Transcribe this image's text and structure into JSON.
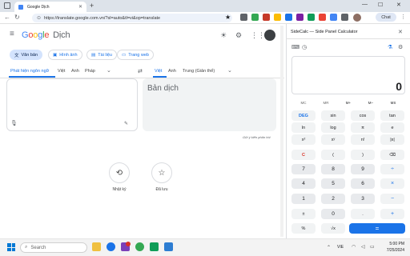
{
  "browser": {
    "tab_title": "Google Dịch",
    "new_tab": "+",
    "url": "https://translate.google.com.vn/?sl=auto&tl=vi&op=translate",
    "minimize": "—",
    "maximize": "☐",
    "close": "✕",
    "profile_label": "Chat"
  },
  "translate": {
    "logo_google": "Google",
    "logo_dich": "Dịch",
    "modes": [
      "Văn bản",
      "Hình ảnh",
      "Tài liệu",
      "Trang web"
    ],
    "source_langs": [
      "Phát hiện ngôn ngữ",
      "Việt",
      "Anh",
      "Pháp"
    ],
    "target_langs": [
      "Việt",
      "Anh",
      "Trung (Giản thể)"
    ],
    "output_placeholder": "Bản dịch",
    "feedback": "Gửi ý kiến phản hồi",
    "history_label": "Nhật ký",
    "saved_label": "Đã lưu"
  },
  "calculator": {
    "title": "SideCalc — Side Panel Calculator",
    "display_value": "0",
    "memory_keys": [
      "MC",
      "MR",
      "M+",
      "M−",
      "MS"
    ],
    "rows": [
      [
        "DEG",
        "sin",
        "cos",
        "tan"
      ],
      [
        "ln",
        "log",
        "π",
        "e"
      ],
      [
        "x²",
        "xʸ",
        "n!",
        "|x|"
      ],
      [
        "C",
        "(",
        ")",
        "⌫"
      ],
      [
        "7",
        "8",
        "9",
        "÷"
      ],
      [
        "4",
        "5",
        "6",
        "×"
      ],
      [
        "1",
        "2",
        "3",
        "−"
      ],
      [
        "±",
        "0",
        ".",
        "+"
      ]
    ],
    "last_row": [
      "%",
      "√x",
      "="
    ]
  },
  "taskbar": {
    "search_placeholder": "Search",
    "language": "VIE",
    "time": "5:00 PM",
    "date": "7/25/2024"
  }
}
